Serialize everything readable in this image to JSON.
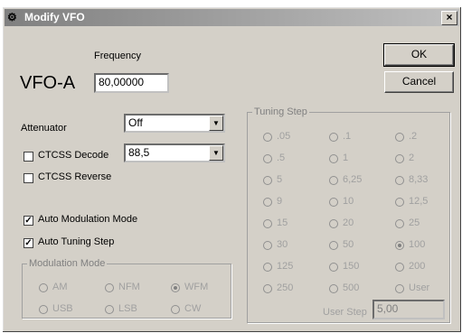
{
  "window": {
    "title": "Modify VFO",
    "close_label": "×"
  },
  "vfo": {
    "label": "VFO-A",
    "frequency_label": "Frequency",
    "frequency_value": "80,00000"
  },
  "buttons": {
    "ok": "OK",
    "cancel": "Cancel"
  },
  "attenuator": {
    "label": "Attenuator",
    "value": "Off"
  },
  "ctcss_decode": {
    "label": "CTCSS Decode",
    "checked": false,
    "value": "88,5"
  },
  "ctcss_reverse": {
    "label": "CTCSS Reverse",
    "checked": false
  },
  "auto_modulation": {
    "label": "Auto Modulation Mode",
    "checked": true
  },
  "auto_tuning": {
    "label": "Auto Tuning Step",
    "checked": true
  },
  "modulation": {
    "title": "Modulation Mode",
    "options": [
      "AM",
      "NFM",
      "WFM",
      "USB",
      "LSB",
      "CW"
    ],
    "selected": "WFM"
  },
  "tuning": {
    "title": "Tuning Step",
    "options": [
      ".05",
      ".1",
      ".2",
      ".5",
      "1",
      "2",
      "5",
      "6,25",
      "8,33",
      "9",
      "10",
      "12,5",
      "15",
      "20",
      "25",
      "30",
      "50",
      "100",
      "125",
      "150",
      "200",
      "250",
      "500",
      "User"
    ],
    "selected": "100",
    "user_step_label": "User Step",
    "user_step_value": "5,00"
  },
  "glyphs": {
    "check": "✓",
    "arrow": "▼",
    "app_icon": "🖫"
  }
}
